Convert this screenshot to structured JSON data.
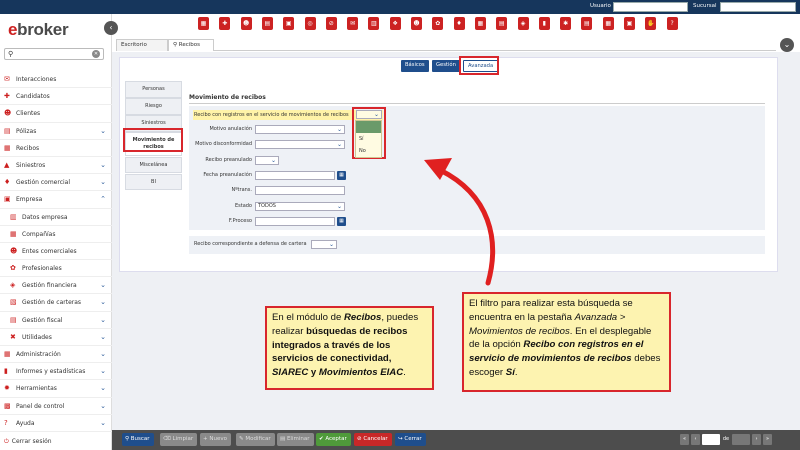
{
  "app": {
    "logo_e": "e",
    "logo_rest": "broker"
  },
  "topbar": {
    "usuario_label": "Usuario",
    "sucursal_label": "Sucursal"
  },
  "tabs": [
    {
      "label": "Escritorio"
    },
    {
      "label": "Recibos"
    }
  ],
  "modes": {
    "basicos": "Básicos",
    "gestion": "Gestión",
    "avanzada": "Avanzada"
  },
  "sidebar": {
    "items": [
      {
        "label": "Interacciones",
        "icon": "chat-icon",
        "chev": ""
      },
      {
        "label": "Candidatos",
        "icon": "user-plus-icon",
        "chev": ""
      },
      {
        "label": "Clientes",
        "icon": "users-icon",
        "chev": ""
      },
      {
        "label": "Pólizas",
        "icon": "document-icon",
        "chev": "⌄"
      },
      {
        "label": "Recibos",
        "icon": "receipt-icon",
        "chev": ""
      },
      {
        "label": "Siniestros",
        "icon": "car-icon",
        "chev": "⌄"
      },
      {
        "label": "Gestión comercial",
        "icon": "handshake-icon",
        "chev": "⌄"
      },
      {
        "label": "Empresa",
        "icon": "briefcase-icon",
        "chev": "⌃"
      },
      {
        "label": "Datos empresa",
        "icon": "building-icon",
        "chev": "",
        "sub": true
      },
      {
        "label": "Compañías",
        "icon": "company-icon",
        "chev": "",
        "sub": true
      },
      {
        "label": "Entes comerciales",
        "icon": "person-icon",
        "chev": "",
        "sub": true
      },
      {
        "label": "Profesionales",
        "icon": "team-icon",
        "chev": "",
        "sub": true
      },
      {
        "label": "Gestión financiera",
        "icon": "money-icon",
        "chev": "⌄",
        "sub": true
      },
      {
        "label": "Gestión de carteras",
        "icon": "portfolio-icon",
        "chev": "⌄",
        "sub": true
      },
      {
        "label": "Gestión fiscal",
        "icon": "tax-icon",
        "chev": "⌄",
        "sub": true
      },
      {
        "label": "Utilidades",
        "icon": "tools-icon",
        "chev": "⌄",
        "sub": true
      },
      {
        "label": "Administración",
        "icon": "admin-icon",
        "chev": "⌄"
      },
      {
        "label": "Informes y estadísticas",
        "icon": "chart-icon",
        "chev": "⌄"
      },
      {
        "label": "Herramientas",
        "icon": "gear-icon",
        "chev": "⌄"
      },
      {
        "label": "Panel de control",
        "icon": "panel-icon",
        "chev": "⌄"
      },
      {
        "label": "Ayuda",
        "icon": "help-icon",
        "chev": "⌄"
      }
    ],
    "logout": "Cerrar sesión"
  },
  "subtabs": [
    "Personas",
    "Riesgo",
    "Siniestros",
    "Movimiento de recibos",
    "Miscelánea",
    "BI"
  ],
  "form": {
    "section_title": "Movimiento de recibos",
    "row1_label": "Recibo con registros en el servicio de movimientos de recibos",
    "motivo_anulacion": "Motivo anulación",
    "motivo_disconformidad": "Motivo disconformidad",
    "recibo_preanulado": "Recibo preanulado",
    "fecha_preanulacion": "Fecha preanulación",
    "ntrans": "Nºtrans.",
    "estado": "Estado",
    "estado_value": "TODOS",
    "fproceso": "F.Proceso",
    "defensa_label": "Recibo correspondiente a defensa de cartera",
    "options": [
      "Sí",
      "No"
    ]
  },
  "bottombar": {
    "buscar": "Buscar",
    "limpiar": "Limpiar",
    "nuevo": "Nuevo",
    "modificar": "Modificar",
    "eliminar": "Eliminar",
    "aceptar": "Aceptar",
    "cancelar": "Cancelar",
    "cerrar": "Cerrar",
    "pager_de": "de"
  },
  "notes": {
    "left": {
      "t1": "En el módulo de ",
      "t2": "Recibos",
      "t3": ", puedes realizar ",
      "t4": "búsquedas de recibos integrados a través de los servicios de conectividad, ",
      "t5": "SIAREC",
      "t6": " y ",
      "t7": "Movimientos EIAC",
      "t8": "."
    },
    "right": {
      "t1": "El filtro para realizar esta búsqueda se encuentra en la pestaña ",
      "t2": "Avanzada > Movimientos de recibos",
      "t3": ". En el desplegable de la opción ",
      "t4": "Recibo con registros en el servicio de movimientos de recibos",
      "t5": " debes escoger ",
      "t6": "Sí",
      "t7": "."
    }
  },
  "colors": {
    "brand_red": "#cc1f1f",
    "navy": "#16365c",
    "note_bg": "#fdf3b0",
    "note_border": "#d8262c"
  }
}
